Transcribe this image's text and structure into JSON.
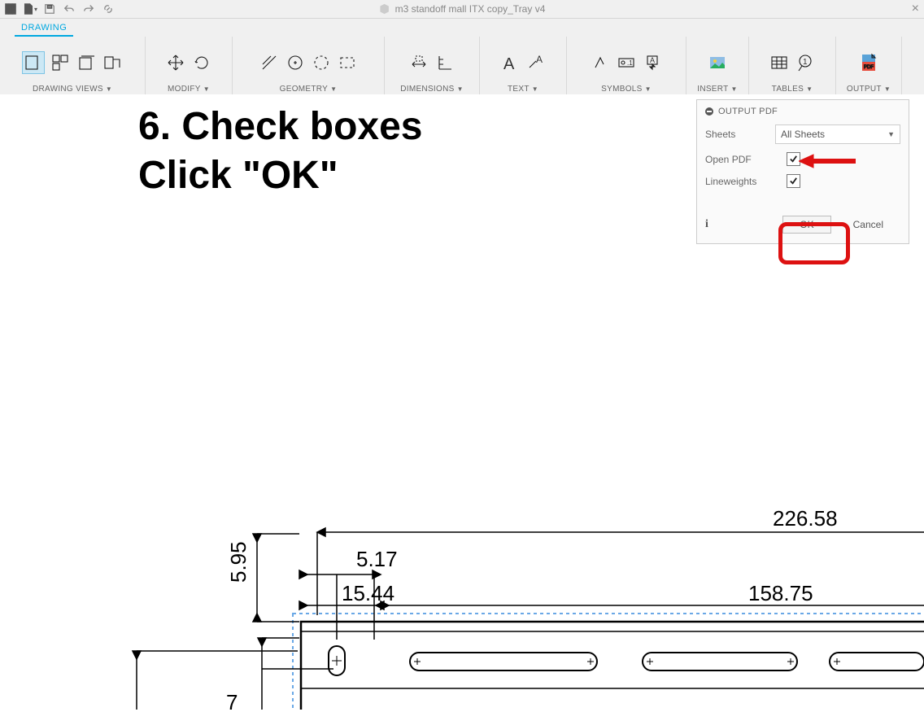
{
  "titlebar": {
    "document_name": "m3 standoff mall ITX copy_Tray v4"
  },
  "tabs": {
    "drawing": "DRAWING"
  },
  "ribbon": {
    "drawing_views": "DRAWING VIEWS",
    "modify": "MODIFY",
    "geometry": "GEOMETRY",
    "dimensions": "DIMENSIONS",
    "text": "TEXT",
    "symbols": "SYMBOLS",
    "insert": "INSERT",
    "tables": "TABLES",
    "output": "OUTPUT"
  },
  "instruction": "6. Check boxes\nClick \"OK\"",
  "dialog": {
    "title": "OUTPUT PDF",
    "sheets_label": "Sheets",
    "sheets_value": "All Sheets",
    "open_pdf_label": "Open PDF",
    "lineweights_label": "Lineweights",
    "ok": "OK",
    "cancel": "Cancel"
  },
  "dimensions": {
    "d1": "5.95",
    "d2": "5.17",
    "d3": "15.44",
    "d4": "226.58",
    "d5": "158.75",
    "d6": "7"
  }
}
